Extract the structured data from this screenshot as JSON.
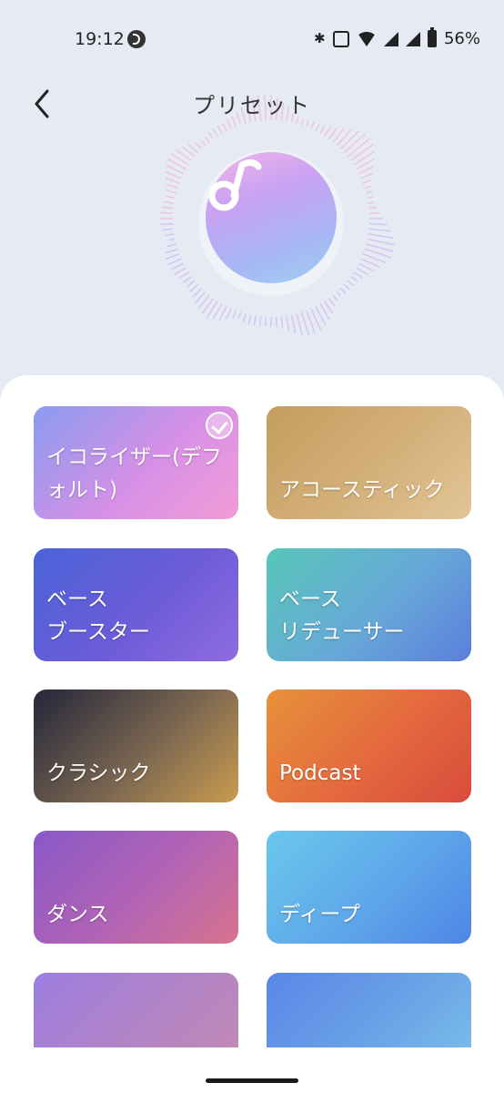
{
  "status": {
    "time": "19:12",
    "battery": "56%"
  },
  "header": {
    "title": "プリセット"
  },
  "icons": {
    "back": "chevron-left-icon",
    "hero": "music-note-icon",
    "check": "check-circle-icon"
  },
  "presets": [
    {
      "label": "イコライザー(デフ\nォルト)",
      "selected": true,
      "colors": [
        "#8a9cf0",
        "#d590e6",
        "#f29cd6"
      ]
    },
    {
      "label": "アコースティック",
      "selected": false,
      "colors": [
        "#c49c5e",
        "#d4b07a",
        "#e2c596"
      ]
    },
    {
      "label": "ベース\nブースター",
      "selected": false,
      "colors": [
        "#4a63d8",
        "#6d5cd8",
        "#8f6be0"
      ]
    },
    {
      "label": "ベース\nリデューサー",
      "selected": false,
      "colors": [
        "#58c6b8",
        "#67a8d8",
        "#5b7fdc"
      ]
    },
    {
      "label": "クラシック",
      "selected": false,
      "colors": [
        "#24263a",
        "#7a6650",
        "#c99c4e"
      ]
    },
    {
      "label": "Podcast",
      "selected": false,
      "colors": [
        "#e6923a",
        "#e4683e",
        "#d84c3c"
      ]
    },
    {
      "label": "ダンス",
      "selected": false,
      "colors": [
        "#8a58c8",
        "#b364b4",
        "#d7738c"
      ]
    },
    {
      "label": "ディープ",
      "selected": false,
      "colors": [
        "#6ac8ec",
        "#5ea6ea",
        "#4f86e6"
      ]
    },
    {
      "label": "",
      "selected": false,
      "colors": [
        "#9c7ee0",
        "#b484c4",
        "#c48cb0"
      ]
    },
    {
      "label": "",
      "selected": false,
      "colors": [
        "#5a86e8",
        "#6aa4e6",
        "#7ec2ea"
      ]
    }
  ]
}
